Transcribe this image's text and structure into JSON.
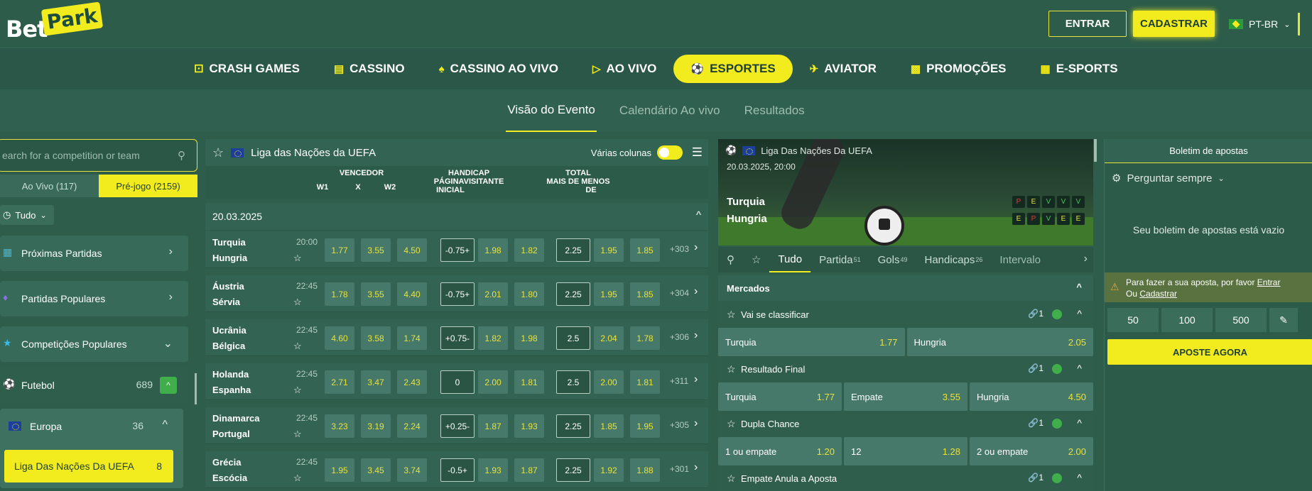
{
  "header": {
    "logo_left": "Bet",
    "logo_right": "Park",
    "login_label": "ENTRAR",
    "register_label": "CADASTRAR",
    "language": "PT-BR"
  },
  "nav": {
    "items": [
      {
        "label": "CRASH GAMES",
        "icon": "dice-icon"
      },
      {
        "label": "CASSINO",
        "icon": "slot-icon"
      },
      {
        "label": "CASSINO AO VIVO",
        "icon": "dealer-icon"
      },
      {
        "label": "AO VIVO",
        "icon": "live-icon"
      },
      {
        "label": "ESPORTES",
        "icon": "soccer-ball-icon"
      },
      {
        "label": "AVIATOR",
        "icon": "plane-icon"
      },
      {
        "label": "PROMOÇÕES",
        "icon": "gift-icon"
      },
      {
        "label": "E-SPORTS",
        "icon": "blocks-icon"
      }
    ]
  },
  "subtabs": [
    "Visão do Evento",
    "Calendário Ao vivo",
    "Resultados"
  ],
  "left": {
    "search_placeholder": "earch for a competition or team",
    "tab_live": "Ao Vivo (117)",
    "tab_pre": "Pré-jogo (2159)",
    "filter": "Tudo",
    "menu": [
      {
        "label": "Próximas Partidas"
      },
      {
        "label": "Partidas Populares"
      },
      {
        "label": "Competições Populares"
      }
    ],
    "football": {
      "label": "Futebol",
      "count": "689"
    },
    "europe": {
      "label": "Europa",
      "count": "36"
    },
    "selected_league": {
      "label": "Liga Das Nações Da UEFA",
      "count": "8"
    }
  },
  "center": {
    "title": "Liga das Nações da UEFA",
    "columns_label": "Várias colunas",
    "headers": {
      "winner": "VENCEDOR",
      "w1": "W1",
      "x": "X",
      "w2": "W2",
      "handicap1": "HANDICAP",
      "handicap2": "PÁGINAVISITANTE",
      "handicap3": "INICIAL",
      "total": "TOTAL",
      "total2": "MAIS DE  MENOS",
      "total3": "DE"
    },
    "date": "20.03.2025",
    "matches": [
      {
        "home": "Turquia",
        "away": "Hungria",
        "time": "20:00",
        "w1": "1.77",
        "x": "3.55",
        "w2": "4.50",
        "hcp": "-0.75+",
        "h1": "1.98",
        "h2": "1.82",
        "tot": "2.25",
        "over": "1.95",
        "under": "1.85",
        "more": "+303"
      },
      {
        "home": "Áustria",
        "away": "Sérvia",
        "time": "22:45",
        "w1": "1.78",
        "x": "3.55",
        "w2": "4.40",
        "hcp": "-0.75+",
        "h1": "2.01",
        "h2": "1.80",
        "tot": "2.25",
        "over": "1.95",
        "under": "1.85",
        "more": "+304"
      },
      {
        "home": "Ucrânia",
        "away": "Bélgica",
        "time": "22:45",
        "w1": "4.60",
        "x": "3.58",
        "w2": "1.74",
        "hcp": "+0.75-",
        "h1": "1.82",
        "h2": "1.98",
        "tot": "2.5",
        "over": "2.04",
        "under": "1.78",
        "more": "+306"
      },
      {
        "home": "Holanda",
        "away": "Espanha",
        "time": "22:45",
        "w1": "2.71",
        "x": "3.47",
        "w2": "2.43",
        "hcp": "0",
        "h1": "2.00",
        "h2": "1.81",
        "tot": "2.5",
        "over": "2.00",
        "under": "1.81",
        "more": "+311"
      },
      {
        "home": "Dinamarca",
        "away": "Portugal",
        "time": "22:45",
        "w1": "3.23",
        "x": "3.19",
        "w2": "2.24",
        "hcp": "+0.25-",
        "h1": "1.87",
        "h2": "1.93",
        "tot": "2.25",
        "over": "1.85",
        "under": "1.95",
        "more": "+305"
      },
      {
        "home": "Grécia",
        "away": "Escócia",
        "time": "22:45",
        "w1": "1.95",
        "x": "3.45",
        "w2": "3.74",
        "hcp": "-0.5+",
        "h1": "1.93",
        "h2": "1.87",
        "tot": "2.25",
        "over": "1.92",
        "under": "1.88",
        "more": "+301"
      }
    ]
  },
  "event": {
    "league": "Liga Das Nações Da UEFA",
    "datetime": "20.03.2025, 20:00",
    "home": "Turquia",
    "away": "Hungria",
    "form_home": [
      "P",
      "E",
      "V",
      "V",
      "V"
    ],
    "form_away": [
      "E",
      "P",
      "V",
      "E",
      "E"
    ],
    "tabs": [
      {
        "label": "Tudo",
        "count": ""
      },
      {
        "label": "Partida",
        "count": "51"
      },
      {
        "label": "Gols",
        "count": "49"
      },
      {
        "label": "Handicaps",
        "count": "26"
      },
      {
        "label": "Intervalo",
        "count": ""
      }
    ],
    "markets_title": "Mercados",
    "markets": [
      {
        "name": "Vai se classificar",
        "count": "1",
        "outcomes": [
          {
            "label": "Turquia",
            "odd": "1.77"
          },
          {
            "label": "Hungria",
            "odd": "2.05"
          }
        ]
      },
      {
        "name": "Resultado Final",
        "count": "1",
        "outcomes": [
          {
            "label": "Turquia",
            "odd": "1.77"
          },
          {
            "label": "Empate",
            "odd": "3.55"
          },
          {
            "label": "Hungria",
            "odd": "4.50"
          }
        ]
      },
      {
        "name": "Dupla Chance",
        "count": "1",
        "outcomes": [
          {
            "label": "1 ou empate",
            "odd": "1.20"
          },
          {
            "label": "12",
            "odd": "1.28"
          },
          {
            "label": "2 ou empate",
            "odd": "2.00"
          }
        ]
      },
      {
        "name": "Empate Anula a Aposta",
        "count": "1",
        "outcomes": []
      }
    ]
  },
  "slip": {
    "title": "Boletim de apostas",
    "ask": "Perguntar sempre",
    "empty": "Seu boletim de apostas está vazio",
    "warn_text": "Para fazer a sua aposta, por favor",
    "warn_login": "Entrar",
    "warn_or": "Ou",
    "warn_register": "Cadastrar",
    "stakes": [
      "50",
      "100",
      "500"
    ],
    "submit": "APOSTE AGORA"
  }
}
